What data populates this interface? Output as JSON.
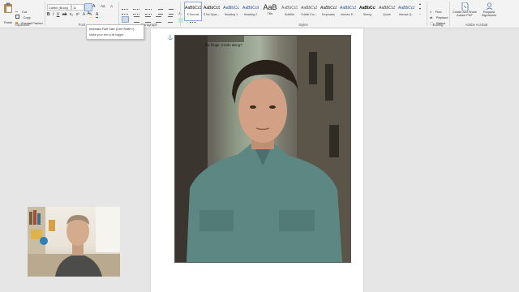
{
  "clipboard": {
    "paste": "Paste",
    "cut": "Cut",
    "copy": "Copy",
    "format_painter": "Format Painter",
    "label": "Clipboard"
  },
  "font": {
    "family": "Calibri (Body)",
    "size": "11",
    "label": "Font"
  },
  "paragraph": {
    "label": "Paragraph"
  },
  "styles": {
    "label": "Styles",
    "items": [
      {
        "sample": "AaBbCcDc",
        "name": "¶ Normal"
      },
      {
        "sample": "AaBbCcDc",
        "name": "¶ No Spac..."
      },
      {
        "sample": "AaBbCc",
        "name": "Heading 1"
      },
      {
        "sample": "AaBbCcE",
        "name": "Heading 2"
      },
      {
        "sample": "AaB",
        "name": "Title"
      },
      {
        "sample": "AaBbCcD",
        "name": "Subtitle"
      },
      {
        "sample": "AaBbCcDc",
        "name": "Subtle Em..."
      },
      {
        "sample": "AaBbCcDc",
        "name": "Emphasis"
      },
      {
        "sample": "AaBbCcDc",
        "name": "Intense E..."
      },
      {
        "sample": "AaBbCcDc",
        "name": "Strong"
      },
      {
        "sample": "AaBbCcDc",
        "name": "Quote"
      },
      {
        "sample": "AaBbCcDc",
        "name": "Intense Q..."
      }
    ]
  },
  "editing": {
    "find": "Find",
    "replace": "Replace",
    "select": "Select",
    "label": "Editing"
  },
  "acrobat": {
    "create_share": "Create and Share Adobe PDF",
    "request_sig": "Request Signatures",
    "label": "Adobe Acrobat"
  },
  "tooltip": {
    "title": "Increase Font Size (Ctrl+Shift+>)",
    "desc": "Make your text a bit bigger."
  },
  "doc": {
    "caption": "the fringe. Coolin along?"
  },
  "colors": {
    "accent": "#2b579a",
    "font_color_bar": "#d32f2f",
    "highlight_bar": "#ffeb3b"
  }
}
